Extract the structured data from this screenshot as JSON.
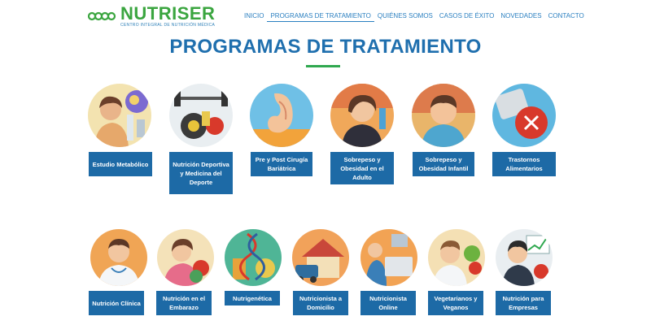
{
  "brand": {
    "name": "NUTRISER",
    "tagline": "CENTRO INTEGRAL DE NUTRICIÓN MÉDICA"
  },
  "nav": [
    "INICIO",
    "PROGRAMAS DE TRATAMIENTO",
    "QUIÉNES SOMOS",
    "CASOS DE ÉXITO",
    "NOVEDADES",
    "CONTACTO"
  ],
  "page": {
    "title": "PROGRAMAS DE TRATAMIENTO"
  },
  "programs_row1": [
    {
      "label": "Estudio Metabólico",
      "icon": "metabolic-study-icon"
    },
    {
      "label": "Nutrición Deportiva y Medicina del Deporte",
      "icon": "sports-nutrition-icon"
    },
    {
      "label": "Pre y Post Cirugía Bariátrica",
      "icon": "bariatric-surgery-icon"
    },
    {
      "label": "Sobrepeso y Obesidad en el Adulto",
      "icon": "adult-overweight-icon"
    },
    {
      "label": "Sobrepeso y Obesidad Infantil",
      "icon": "child-overweight-icon"
    },
    {
      "label": "Trastornos Alimentarios",
      "icon": "eating-disorders-icon"
    }
  ],
  "programs_row2": [
    {
      "label": "Nutrición Clínica",
      "icon": "clinical-nutrition-icon"
    },
    {
      "label": "Nutrición en el Embarazo",
      "icon": "pregnancy-nutrition-icon"
    },
    {
      "label": "Nutrigenética",
      "icon": "nutrigenetics-icon"
    },
    {
      "label": "Nutricionista a Domicilio",
      "icon": "home-nutritionist-icon"
    },
    {
      "label": "Nutricionista Online",
      "icon": "online-nutritionist-icon"
    },
    {
      "label": "Vegetarianos y Veganos",
      "icon": "vegetarian-vegan-icon"
    },
    {
      "label": "Nutrición para Empresas",
      "icon": "corporate-nutrition-icon"
    }
  ],
  "colors": {
    "brand_green": "#3aa53f",
    "brand_blue": "#1f6fae",
    "button_blue": "#1d6aa6",
    "accent_green": "#2fa84f"
  }
}
